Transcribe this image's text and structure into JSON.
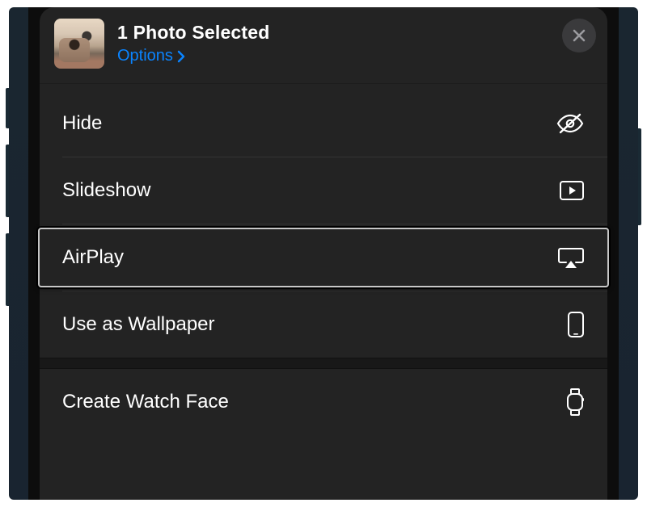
{
  "header": {
    "title": "1 Photo Selected",
    "options_label": "Options"
  },
  "actions": {
    "hide": "Hide",
    "slideshow": "Slideshow",
    "airplay": "AirPlay",
    "use_as_wallpaper": "Use as Wallpaper",
    "create_watch_face": "Create Watch Face"
  },
  "colors": {
    "link": "#0a84ff",
    "sheet_bg": "#232323"
  }
}
